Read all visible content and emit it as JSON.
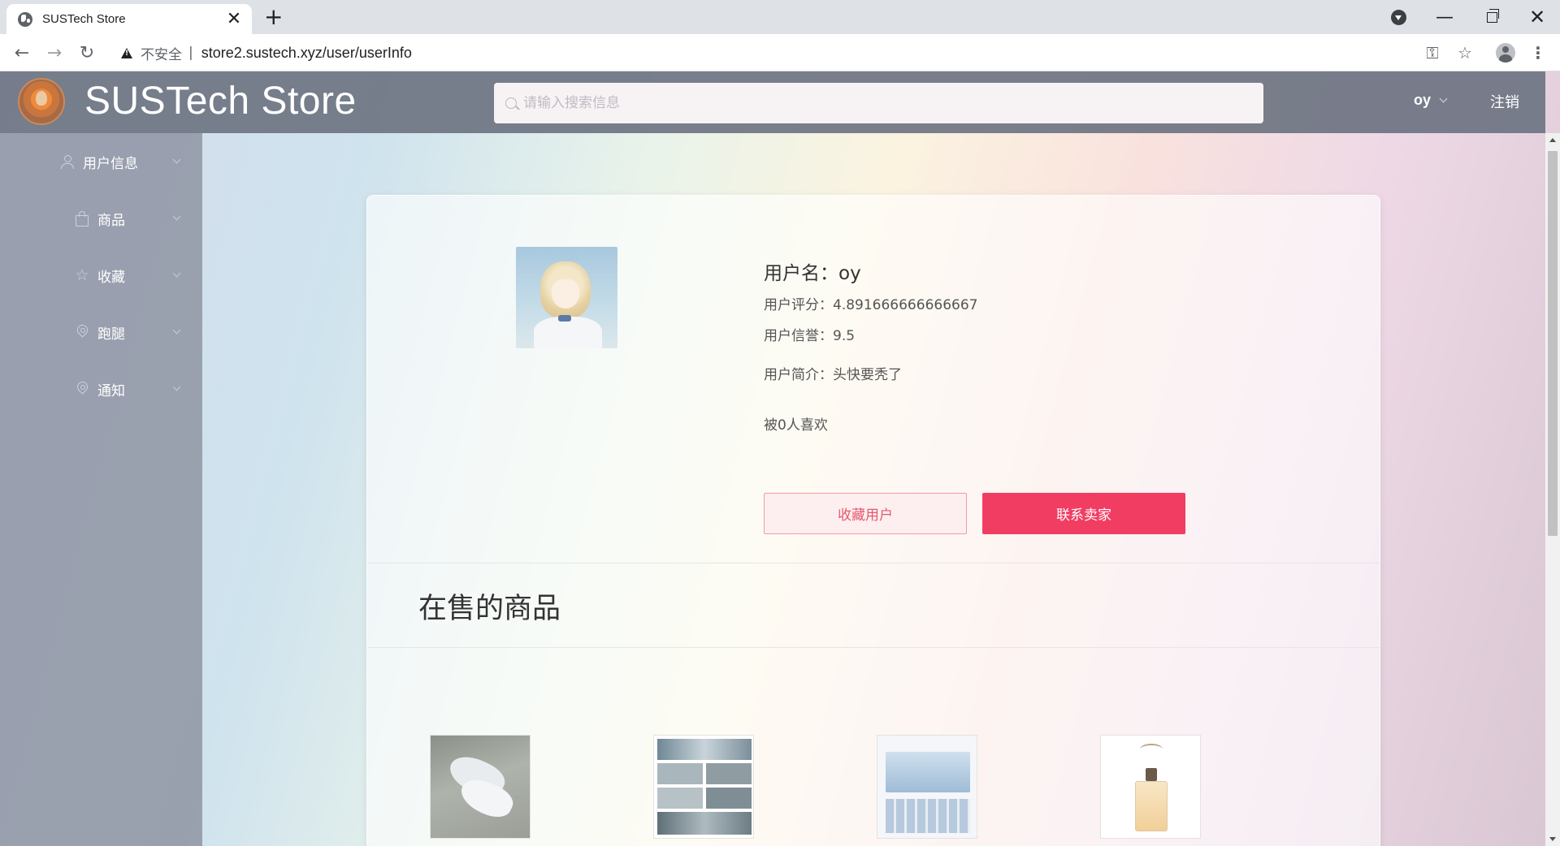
{
  "browser": {
    "tab_title": "SUSTech Store",
    "tab_close": "✕",
    "new_tab": "+",
    "window_min": "—",
    "window_close": "✕",
    "security_label": "不安全",
    "url_separator": "|",
    "url": "store2.sustech.xyz/user/userInfo",
    "nav_back": "←",
    "nav_forward": "→",
    "nav_reload": "↻",
    "key_icon": "⚿",
    "star_icon": "☆",
    "menu_icon": "⋮"
  },
  "header": {
    "brand": "SUSTech Store",
    "search_placeholder": "请输入搜索信息",
    "username": "oy",
    "logout": "注销"
  },
  "sidebar": {
    "items": [
      {
        "label": "用户信息",
        "icon": "user-icon"
      },
      {
        "label": "商品",
        "icon": "bag-icon"
      },
      {
        "label": "收藏",
        "icon": "star-icon"
      },
      {
        "label": "跑腿",
        "icon": "location-icon"
      },
      {
        "label": "通知",
        "icon": "location-icon"
      }
    ],
    "star_glyph": "☆"
  },
  "profile": {
    "name_line": "用户名：oy",
    "rating_line": "用户评分：4.891666666666667",
    "credit_line": "用户信誉：9.5",
    "bio_line": "用户简介：头快要秃了",
    "likes_line": "被0人喜欢",
    "favorite_button": "收藏用户",
    "contact_button": "联系卖家"
  },
  "on_sale": {
    "title": "在售的商品",
    "items": [
      {
        "image": "shoes-photo"
      },
      {
        "image": "collage-photo"
      },
      {
        "image": "document-photo"
      },
      {
        "image": "perfume-photo"
      }
    ]
  },
  "colors": {
    "header_bg": "#6e7482",
    "sidebar_bg": "#9196a5",
    "accent": "#f23d63",
    "accent_light_border": "#f59aa8"
  }
}
